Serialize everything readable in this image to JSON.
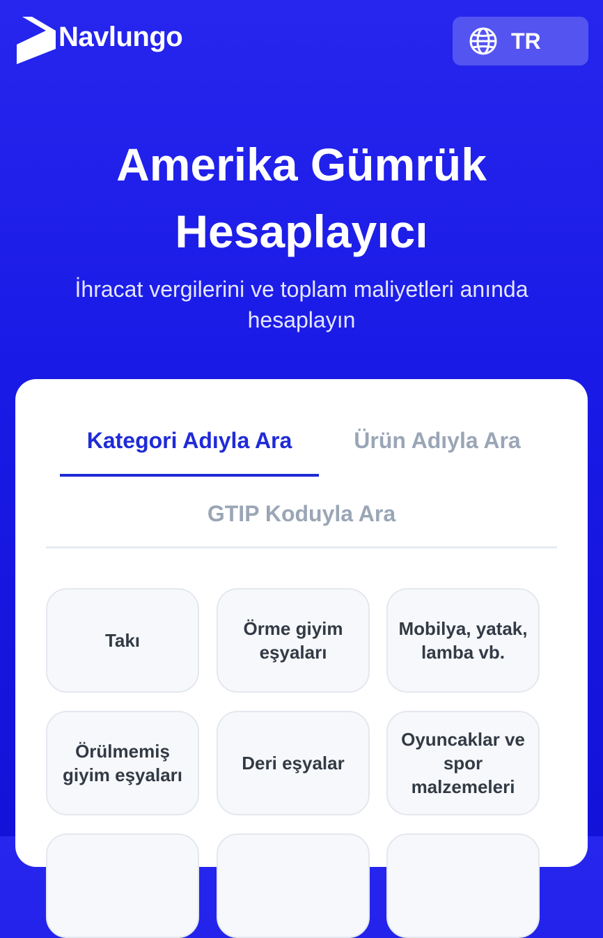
{
  "header": {
    "brand": "Navlungo",
    "language_label": "TR",
    "language_icon": "globe-icon"
  },
  "hero": {
    "title_line1": "Amerika Gümrük",
    "title_line2": "Hesaplayıcı",
    "subtitle_line1": "İhracat vergilerini ve toplam maliyetleri anında",
    "subtitle_line2": "hesaplayın"
  },
  "tabs": [
    {
      "label": "Kategori Adıyla Ara",
      "active": true
    },
    {
      "label": "Ürün Adıyla Ara",
      "active": false
    },
    {
      "label": "GTIP Koduyla Ara",
      "active": false
    }
  ],
  "categories": [
    {
      "label": "Takı"
    },
    {
      "label": "Örme giyim eşyaları"
    },
    {
      "label": "Mobilya, yatak, lamba vb."
    },
    {
      "label": "Örülmemiş giyim eşyaları"
    },
    {
      "label": "Deri eşyalar"
    },
    {
      "label": "Oyuncaklar ve spor malzemeleri"
    }
  ],
  "colors": {
    "background": "#1a1ae6",
    "accent": "#1f2bd6",
    "inactive_tab": "#9aa6b6"
  }
}
